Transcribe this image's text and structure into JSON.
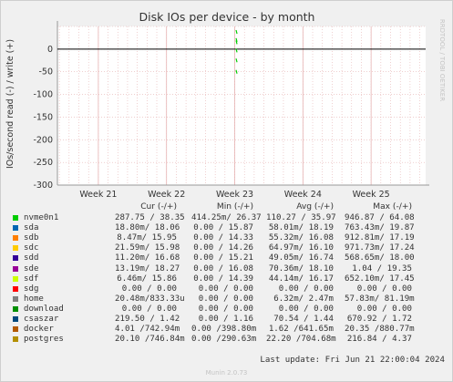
{
  "chart_data": {
    "type": "line",
    "title": "Disk IOs per device - by month",
    "ylabel": "IOs/second read (-) / write (+)",
    "ylim": [
      -300,
      50
    ],
    "yticks": [
      50,
      0,
      -50,
      -100,
      -150,
      -200,
      -250,
      -300
    ],
    "ytick_labels": [
      "",
      "0",
      "-50",
      "-100",
      "-150",
      "-200",
      "-250",
      "-300"
    ],
    "xlim_weeks": [
      20.4,
      25.8
    ],
    "xticks": [
      {
        "week": 21,
        "label": "Week 21"
      },
      {
        "week": 22,
        "label": "Week 22"
      },
      {
        "week": 23,
        "label": "Week 23"
      },
      {
        "week": 24,
        "label": "Week 24"
      },
      {
        "week": 25,
        "label": "Week 25"
      }
    ],
    "grid": true,
    "zero_line": true,
    "spike": {
      "week": 23.02,
      "points": [
        38,
        20,
        15,
        -3,
        -25,
        -50
      ]
    },
    "side_label": "RRDTOOL / TOBI OETIKER",
    "legend": {
      "headers": [
        "Cur (-/+)",
        "Min (-/+)",
        "Avg (-/+)",
        "Max (-/+)"
      ],
      "series": [
        {
          "name": "nvme0n1",
          "color": "#00cc00",
          "cur": "287.75 / 38.35",
          "min": "414.25m/ 26.37",
          "avg": "110.27 / 35.97",
          "max": "946.87 / 64.08"
        },
        {
          "name": "sda",
          "color": "#0066b3",
          "cur": "18.80m/ 18.06",
          "min": "0.00 / 15.87",
          "avg": "58.01m/ 18.19",
          "max": "763.43m/ 19.87"
        },
        {
          "name": "sdb",
          "color": "#ff8000",
          "cur": "8.47m/ 15.95",
          "min": "0.00 / 14.33",
          "avg": "55.32m/ 16.08",
          "max": "912.81m/ 17.19"
        },
        {
          "name": "sdc",
          "color": "#ffcc00",
          "cur": "21.59m/ 15.98",
          "min": "0.00 / 14.26",
          "avg": "64.97m/ 16.10",
          "max": "971.73m/ 17.24"
        },
        {
          "name": "sdd",
          "color": "#330099",
          "cur": "11.20m/ 16.68",
          "min": "0.00 / 15.21",
          "avg": "49.05m/ 16.74",
          "max": "568.65m/ 18.00"
        },
        {
          "name": "sde",
          "color": "#990099",
          "cur": "13.19m/ 18.27",
          "min": "0.00 / 16.08",
          "avg": "70.36m/ 18.10",
          "max": "1.04 / 19.35"
        },
        {
          "name": "sdf",
          "color": "#ccff00",
          "cur": "6.46m/ 15.86",
          "min": "0.00 / 14.39",
          "avg": "44.14m/ 16.17",
          "max": "652.10m/ 17.45"
        },
        {
          "name": "sdg",
          "color": "#ff0000",
          "cur": "0.00 / 0.00",
          "min": "0.00 / 0.00",
          "avg": "0.00 / 0.00",
          "max": "0.00 / 0.00"
        },
        {
          "name": "home",
          "color": "#808080",
          "cur": "20.48m/833.33u",
          "min": "0.00 / 0.00",
          "avg": "6.32m/ 2.47m",
          "max": "57.83m/ 81.19m"
        },
        {
          "name": "download",
          "color": "#008f00",
          "cur": "0.00 / 0.00",
          "min": "0.00 / 0.00",
          "avg": "0.00 / 0.00",
          "max": "0.00 / 0.00"
        },
        {
          "name": "csaszar",
          "color": "#00487d",
          "cur": "219.50 / 1.42",
          "min": "0.00 / 1.16",
          "avg": "70.54 / 1.44",
          "max": "670.92 / 1.72"
        },
        {
          "name": "docker",
          "color": "#b35a00",
          "cur": "4.01 /742.94m",
          "min": "0.00 /398.80m",
          "avg": "1.62 /641.65m",
          "max": "20.35 /880.77m"
        },
        {
          "name": "postgres",
          "color": "#b38f00",
          "cur": "20.10 /746.84m",
          "min": "0.00 /290.63m",
          "avg": "22.20 /704.68m",
          "max": "216.84 / 4.37"
        }
      ]
    }
  },
  "last_update": "Last update: Fri Jun 21 22:00:04 2024",
  "footer": "Munin 2.0.73"
}
